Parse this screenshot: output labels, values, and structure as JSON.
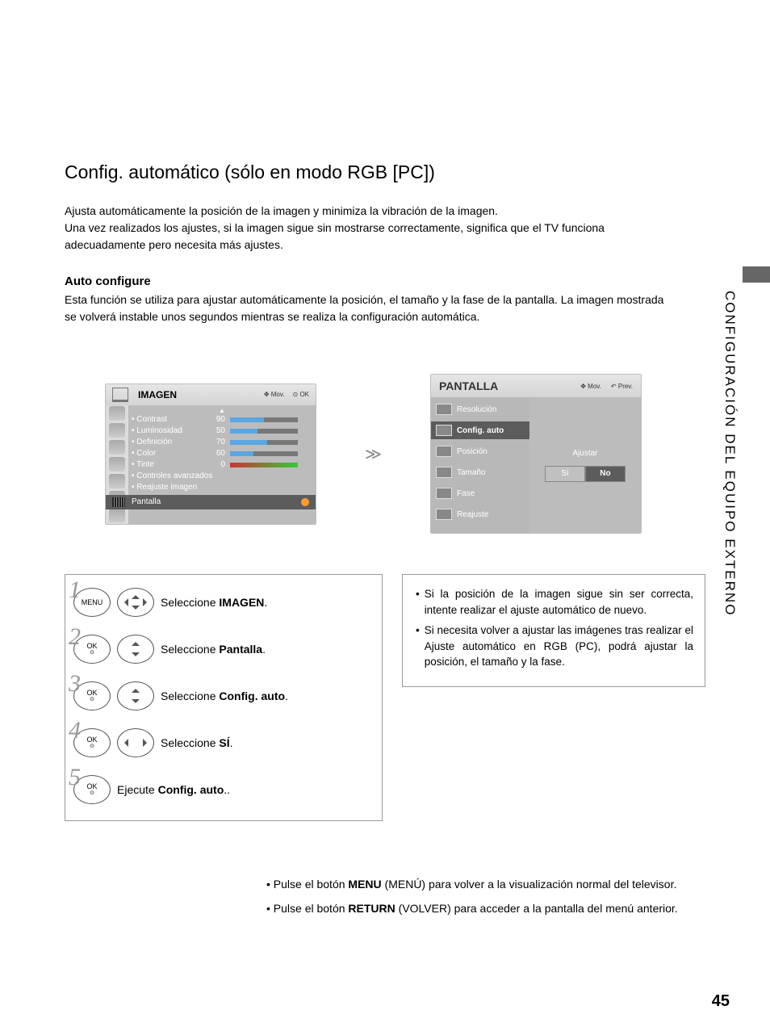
{
  "side_section": "CONFIGURACIÓN DEL EQUIPO EXTERNO",
  "title": "Config. automático (sólo en modo RGB [PC])",
  "intro1": "Ajusta automáticamente la posición de la imagen y minimiza la vibración de la imagen.",
  "intro2": "Una vez realizados los ajustes, si la imagen sigue sin mostrarse correctamente, significa que el TV funciona adecuadamente pero necesita más ajustes.",
  "subhead": "Auto configure",
  "desc": "Esta función se utiliza para ajustar automáticamente la posición, el tamaño y la fase de la pantalla. La imagen mostrada se volverá instable unos segundos mientras se realiza la configuración automática.",
  "osd_imagen": {
    "title": "IMAGEN",
    "mov": "Mov.",
    "ok": "OK",
    "items": [
      {
        "label": "• Contrast",
        "val": "90",
        "fill": 50
      },
      {
        "label": "• Luminosidad",
        "val": "50",
        "fill": 40
      },
      {
        "label": "• Definición",
        "val": "70",
        "fill": 55
      },
      {
        "label": "• Color",
        "val": "60",
        "fill": 35
      },
      {
        "label": "• Tinte",
        "val": "0",
        "fill": 0
      }
    ],
    "extra1": "• Controles avanzados",
    "extra2": "• Reajuste imagen",
    "highlight": "Pantalla"
  },
  "osd_pantalla": {
    "title": "PANTALLA",
    "mov": "Mov.",
    "prev": "Prev.",
    "items": [
      "Resolución",
      "Config. auto",
      "Posición",
      "Tamaño",
      "Fase",
      "Reajuste"
    ],
    "selected_index": 1,
    "ajustar": "Ajustar",
    "yes": "Sí",
    "no": "No"
  },
  "steps": [
    {
      "num": "1",
      "btn": "MENU",
      "dpad": "all",
      "text_pre": "Seleccione ",
      "bold": "IMAGEN",
      "text_post": "."
    },
    {
      "num": "2",
      "btn": "OK",
      "dpad": "ud",
      "text_pre": "Seleccione ",
      "bold": "Pantalla",
      "text_post": "."
    },
    {
      "num": "3",
      "btn": "OK",
      "dpad": "ud",
      "text_pre": "Seleccione ",
      "bold": "Config. auto",
      "text_post": "."
    },
    {
      "num": "4",
      "btn": "OK",
      "dpad": "lr",
      "text_pre": "Seleccione ",
      "bold": "SÍ",
      "text_post": "."
    },
    {
      "num": "5",
      "btn": "OK",
      "dpad": "",
      "text_pre": "Ejecute ",
      "bold": "Config. auto",
      "text_post": ".."
    }
  ],
  "notes": [
    "Si la posición de la imagen sigue sin ser correcta, intente realizar el ajuste automático de nuevo.",
    "Si necesita volver a ajustar las imágenes tras realizar el Ajuste automático en RGB (PC), podrá ajustar la posición, el tamaño y la fase."
  ],
  "footer": [
    {
      "pre": "• Pulse el botón ",
      "bold": "MENU",
      "post": " (MENÚ) para volver a la visualización normal del televisor."
    },
    {
      "pre": "• Pulse el botón ",
      "bold": "RETURN",
      "post": " (VOLVER) para acceder a la pantalla del menú anterior."
    }
  ],
  "page_number": "45"
}
